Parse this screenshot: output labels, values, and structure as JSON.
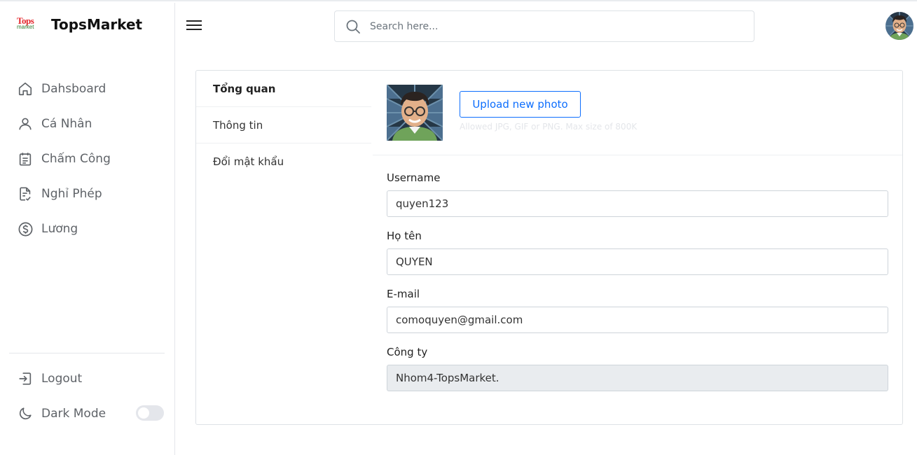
{
  "brand": {
    "logo_line1": "Tops",
    "logo_line2": "market",
    "name": "TopsMarket"
  },
  "sidebar": {
    "items": [
      {
        "label": "Dahsboard",
        "icon": "home-icon"
      },
      {
        "label": "Cá Nhân",
        "icon": "user-icon"
      },
      {
        "label": "Chấm Công",
        "icon": "calendar-icon"
      },
      {
        "label": "Nghỉ Phép",
        "icon": "document-icon"
      },
      {
        "label": "Lương",
        "icon": "dollar-icon"
      }
    ],
    "bottom": {
      "logout_label": "Logout",
      "dark_mode_label": "Dark Mode",
      "dark_mode_on": false
    }
  },
  "header": {
    "search_placeholder": "Search here..."
  },
  "profile": {
    "tabs": [
      {
        "label": "Tổng quan",
        "active": true
      },
      {
        "label": "Thông tin",
        "active": false
      },
      {
        "label": "Đổi mật khẩu",
        "active": false
      }
    ],
    "upload_label": "Upload new photo",
    "upload_hint": "Allowed JPG, GIF or PNG. Max size of 800K",
    "fields": [
      {
        "label": "Username",
        "value": "quyen123",
        "disabled": false
      },
      {
        "label": "Họ tên",
        "value": "QUYEN",
        "disabled": false
      },
      {
        "label": "E-mail",
        "value": "comoquyen@gmail.com",
        "disabled": false
      },
      {
        "label": "Công ty",
        "value": "Nhom4-TopsMarket.",
        "disabled": true
      }
    ]
  },
  "colors": {
    "accent": "#0d6efd",
    "logo_red": "#e3262b",
    "logo_green": "#2e7d32"
  }
}
